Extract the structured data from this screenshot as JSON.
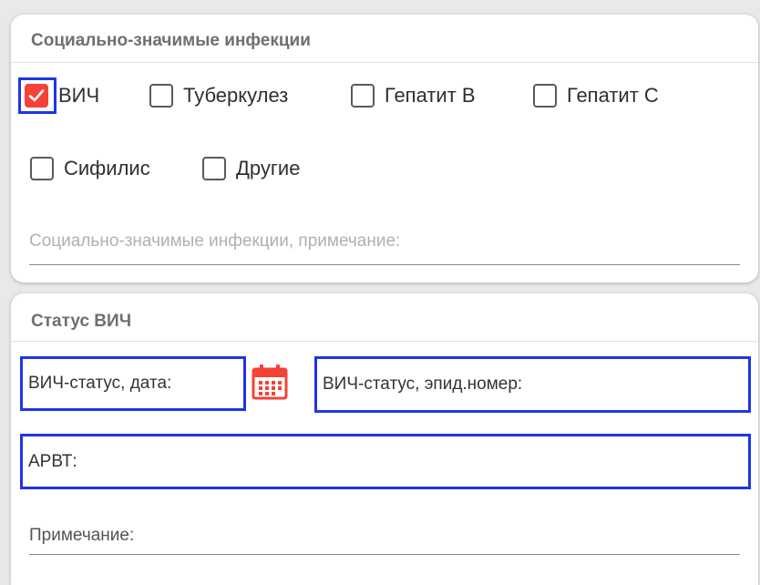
{
  "infections": {
    "title": "Социально-значимые инфекции",
    "checkboxes": [
      {
        "label": "ВИЧ",
        "checked": true
      },
      {
        "label": "Туберкулез",
        "checked": false
      },
      {
        "label": "Гепатит В",
        "checked": false
      },
      {
        "label": "Гепатит С",
        "checked": false
      },
      {
        "label": "Сифилис",
        "checked": false
      },
      {
        "label": "Другие",
        "checked": false
      }
    ],
    "note_placeholder": "Социально-значимые инфекции, примечание:"
  },
  "hiv": {
    "title": "Статус ВИЧ",
    "date_placeholder": "ВИЧ-статус, дата:",
    "epid_placeholder": "ВИЧ-статус, эпид.номер:",
    "arvt_placeholder": "АРВТ:",
    "note_placeholder": "Примечание:"
  },
  "colors": {
    "accent_red": "#f44336",
    "focus_blue": "#1e35e6"
  },
  "icons": {
    "checkmark": "check-icon",
    "calendar": "calendar-icon"
  }
}
